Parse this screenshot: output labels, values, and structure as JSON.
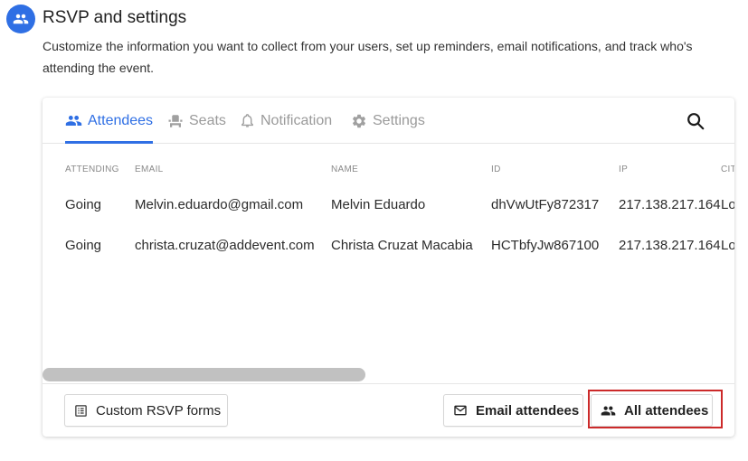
{
  "header": {
    "title": "RSVP and settings",
    "description": "Customize the information you want to collect from your users, set up reminders, email notifications, and track who's attending the event."
  },
  "tabs": [
    {
      "label": "Attendees",
      "icon": "people-icon",
      "active": true
    },
    {
      "label": "Seats",
      "icon": "seat-icon",
      "active": false
    },
    {
      "label": "Notification",
      "icon": "bell-icon",
      "active": false
    },
    {
      "label": "Settings",
      "icon": "gear-icon",
      "active": false
    }
  ],
  "table": {
    "columns": [
      "ATTENDING",
      "EMAIL",
      "NAME",
      "ID",
      "IP",
      "CIT"
    ],
    "rows": [
      [
        "Going",
        "Melvin.eduardo@gmail.com",
        "Melvin Eduardo",
        "dhVwUtFy872317",
        "217.138.217.164",
        "Lo"
      ],
      [
        "Going",
        "christa.cruzat@addevent.com",
        "Christa Cruzat Macabia",
        "HCTbfyJw867100",
        "217.138.217.164",
        "Lo"
      ]
    ]
  },
  "footer": {
    "custom_forms_label": "Custom RSVP forms",
    "email_attendees_label": "Email attendees",
    "all_attendees_label": "All attendees"
  },
  "colors": {
    "accent": "#2f6fe4",
    "highlight": "#cc2a2a"
  }
}
